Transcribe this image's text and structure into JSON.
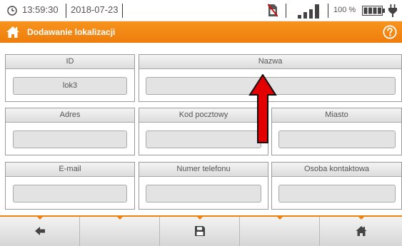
{
  "status": {
    "time": "13:59:30",
    "date": "2018-07-23",
    "battery_percent": "100 %",
    "icons": [
      "clock-icon",
      "no-sim-icon",
      "signal-icon",
      "battery-icon",
      "plug-icon"
    ]
  },
  "header": {
    "title": "Dodawanie lokalizacji",
    "icons": [
      "home-icon",
      "help-icon"
    ],
    "accent_color": "#f7941d"
  },
  "form": {
    "id": {
      "label": "ID",
      "value": "lok3"
    },
    "nazwa": {
      "label": "Nazwa",
      "value": ""
    },
    "adres": {
      "label": "Adres",
      "value": ""
    },
    "kod": {
      "label": "Kod pocztowy",
      "value": ""
    },
    "miasto": {
      "label": "Miasto",
      "value": ""
    },
    "email": {
      "label": "E-mail",
      "value": ""
    },
    "telefon": {
      "label": "Numer telefonu",
      "value": ""
    },
    "osoba": {
      "label": "Osoba kontaktowa",
      "value": ""
    }
  },
  "annotation": {
    "arrow_color": "#e30000",
    "points_to": "Nazwa"
  },
  "toolbar": {
    "buttons": [
      "back-arrow-icon",
      "",
      "save-icon",
      "",
      "home-icon"
    ]
  }
}
